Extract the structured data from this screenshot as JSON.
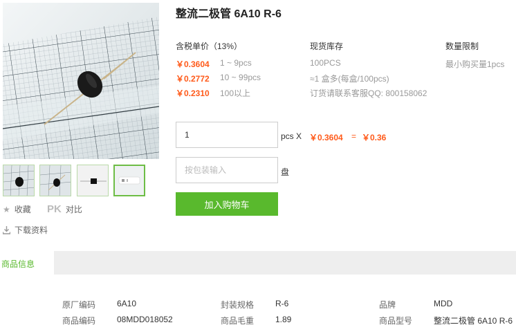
{
  "product": {
    "title": "整流二极管 6A10 R-6"
  },
  "gallery": {
    "thumb_count": 4,
    "active_thumb": 4
  },
  "actions": {
    "favorite_label": "收藏",
    "pk_badge": "PK",
    "compare_label": "对比",
    "download_label": "下载资料"
  },
  "pricing": {
    "header": "含税单价（13%）",
    "tiers": [
      {
        "price": "￥0.3604",
        "range": "1 ~ 9pcs"
      },
      {
        "price": "￥0.2772",
        "range": "10 ~ 99pcs"
      },
      {
        "price": "￥0.2310",
        "range": "100以上"
      }
    ]
  },
  "stock": {
    "header": "现货库存",
    "quantity": "100PCS",
    "box_info": "≈1 盒多(每盒/100pcs)",
    "contact": "订货请联系客服QQ: 800158062"
  },
  "limit": {
    "header": "数量限制",
    "text": "最小购买量1pcs"
  },
  "order": {
    "quantity_value": "1",
    "quantity_unit": "pcs X",
    "unit_price": "￥0.3604",
    "equals": "=",
    "total": "￥0.36",
    "pack_placeholder": "按包装输入",
    "pack_unit": "盘",
    "cart_button": "加入购物车"
  },
  "tabs": {
    "active": "商品信息"
  },
  "specs": [
    {
      "label": "原厂编码",
      "value": "6A10"
    },
    {
      "label": "封装规格",
      "value": "R-6"
    },
    {
      "label": "品牌",
      "value": "MDD"
    },
    {
      "label": "商品编码",
      "value": "08MDD018052"
    },
    {
      "label": "商品毛重",
      "value": "1.89"
    },
    {
      "label": "商品型号",
      "value": "整流二极管 6A10 R-6"
    }
  ],
  "colors": {
    "price": "#ff5a1a",
    "accent_green": "#59b92d",
    "tab_bar": "#eeeeee"
  }
}
